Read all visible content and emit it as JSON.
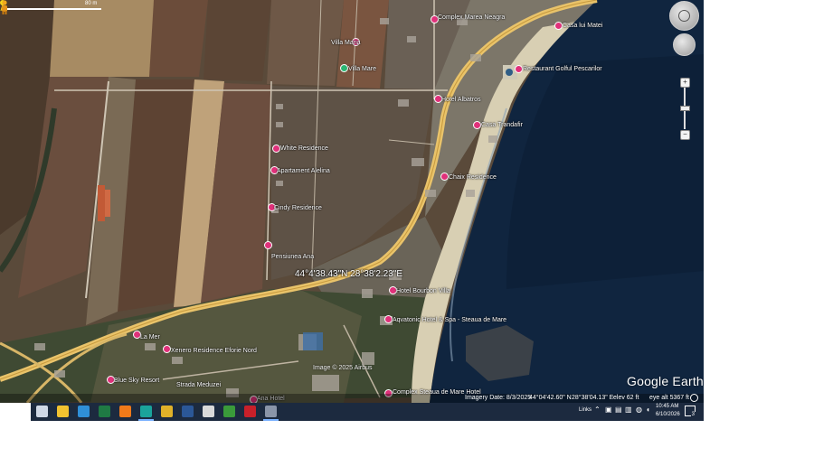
{
  "scale": {
    "label": "80 m"
  },
  "places": [
    {
      "name": "Complex Marea Neagra",
      "kind": "pink"
    },
    {
      "name": "Villa Maria",
      "kind": "pink"
    },
    {
      "name": "Villa Mare",
      "kind": "green"
    },
    {
      "name": "Casa Trandafir",
      "kind": "pink"
    },
    {
      "name": "White Residence",
      "kind": "pink"
    },
    {
      "name": "Apartament Alelina",
      "kind": "pink"
    },
    {
      "name": "Cindy Residence",
      "kind": "pink"
    },
    {
      "name": "Pensiunea Ana",
      "kind": "pink"
    },
    {
      "name": "Chaix Residence",
      "kind": "pink"
    },
    {
      "name": "Restaurant Golful Pescarilor",
      "kind": "pink"
    },
    {
      "name": "Casa lui Matei",
      "kind": "pink"
    },
    {
      "name": "Hotel Albatros",
      "kind": "pink"
    },
    {
      "name": "Hotel Bourbon Villa",
      "kind": "pink"
    },
    {
      "name": "Aqvatonic Hotel & Spa - Steaua de Mare",
      "kind": "pink"
    },
    {
      "name": "La Mer",
      "kind": "pink"
    },
    {
      "name": "Xenero Residence Eforie Nord",
      "kind": "pink"
    },
    {
      "name": "Blue Sky Resort",
      "kind": "pink"
    },
    {
      "name": "Strada Meduzei",
      "kind": "road"
    },
    {
      "name": "Ana Hotel",
      "kind": "pink"
    },
    {
      "name": "Complex Steaua de Mare Hotel",
      "kind": "pink"
    }
  ],
  "placemark": {
    "coordinates": "44°4'38.43\"N  28°38'2.23\"E"
  },
  "imagery_credit": "Image © 2025 Airbus",
  "status": {
    "imagery_date": "Imagery Date: 8/3/2025",
    "lat": "44°04'42.60\" N",
    "lon": "28°38'04.13\" E",
    "elev": "elev   62 ft",
    "eye_alt": "eye alt   5367 ft"
  },
  "logo": "Google Earth",
  "taskbar": {
    "links_label": "Links",
    "time": "10:45 AM",
    "date": "6/10/2026",
    "notification_count": "3",
    "apps": [
      {
        "name": "task-view-icon",
        "color": "#cfd8e6"
      },
      {
        "name": "file-explorer-icon",
        "color": "#f2c230"
      },
      {
        "name": "edge-icon",
        "color": "#2f8fd8"
      },
      {
        "name": "excel-icon",
        "color": "#1f7a44"
      },
      {
        "name": "firefox-icon",
        "color": "#f07a1a"
      },
      {
        "name": "publisher-icon",
        "color": "#1aa39b"
      },
      {
        "name": "chrome-icon",
        "color": "#e0b129"
      },
      {
        "name": "word-icon",
        "color": "#2b5797"
      },
      {
        "name": "acrobat-icon",
        "color": "#d9d9d9"
      },
      {
        "name": "plant-app-icon",
        "color": "#3a9b3a"
      },
      {
        "name": "acrobat-reader-icon",
        "color": "#c8202a"
      },
      {
        "name": "google-earth-icon",
        "color": "#8a95a8"
      }
    ]
  }
}
